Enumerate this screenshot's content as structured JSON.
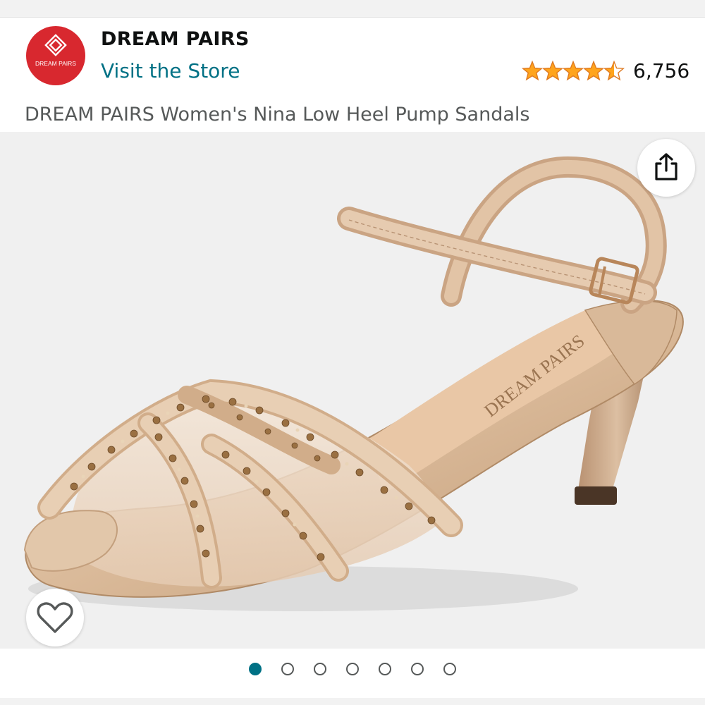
{
  "brand": {
    "name": "DREAM PAIRS",
    "logo_text": "DREAM PAIRS",
    "store_link": "Visit the Store",
    "color": "#d8282f"
  },
  "rating": {
    "stars": 4.5,
    "max_stars": 5,
    "count": "6,756",
    "star_color": "#ffa41c"
  },
  "product": {
    "title": "DREAM PAIRS Women's Nina Low Heel Pump Sandals",
    "insole_print": "DREAM PAIRS"
  },
  "gallery": {
    "current_index": 1,
    "total": 7,
    "active_color": "#007185",
    "share_icon": "share-icon",
    "wishlist_icon": "heart-outline-icon"
  },
  "colors": {
    "link": "#007185",
    "text": "#0f1111",
    "muted": "#565959"
  }
}
